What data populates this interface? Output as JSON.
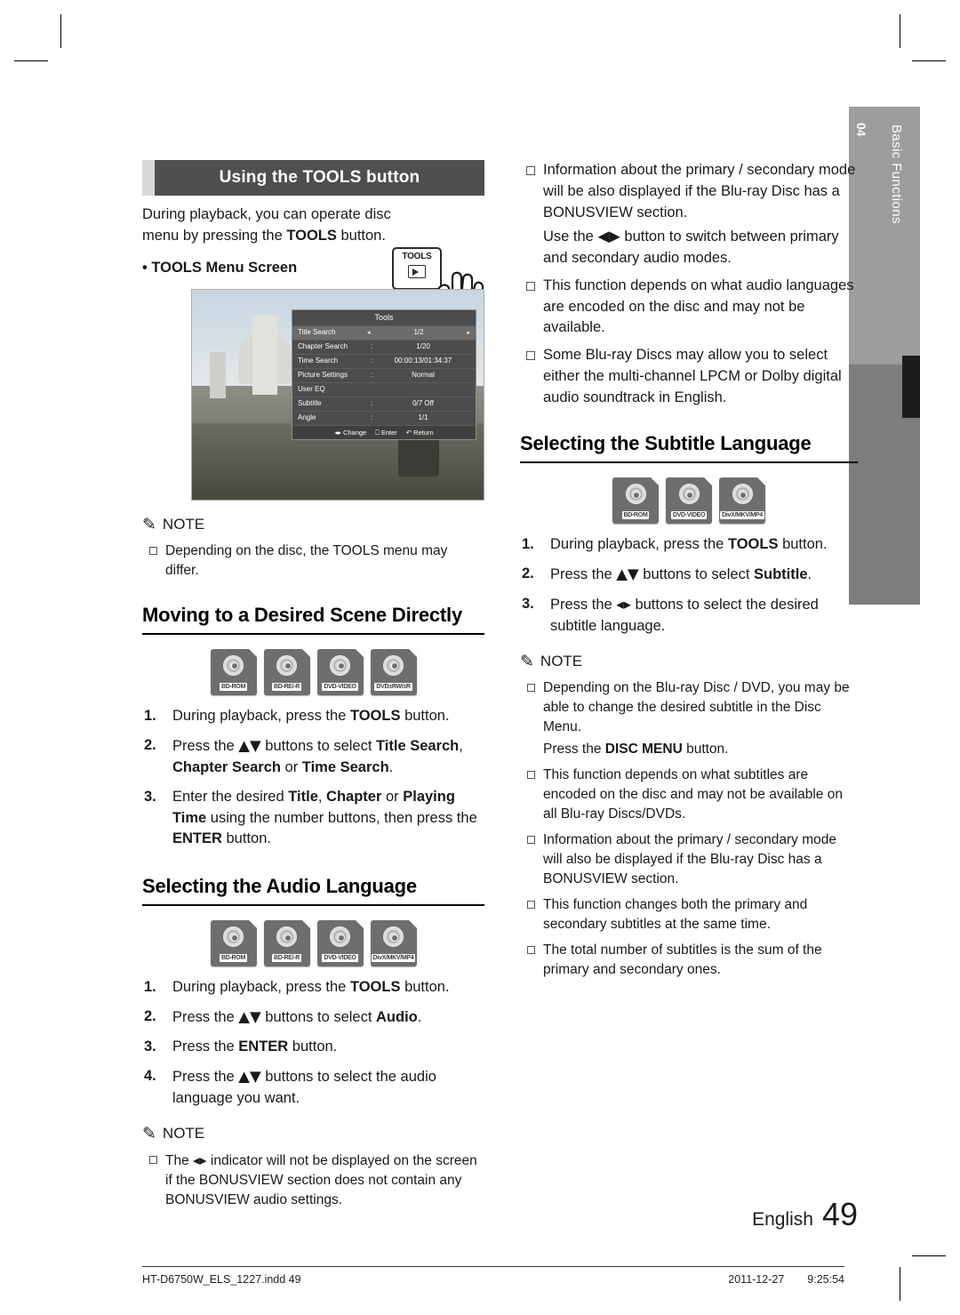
{
  "page": {
    "language_label": "English",
    "page_number": "49",
    "file_name": "HT-D6750W_ELS_1227.indd   49",
    "footer_date": "2011-12-27",
    "footer_time": "9:25:54"
  },
  "sidetab": {
    "chapter_number": "04",
    "chapter_title": "Basic Functions"
  },
  "left_column": {
    "tools_banner": "Using the TOOLS button",
    "intro_text": "During playback, you can operate disc menu by pressing the TOOLS button.",
    "intro_bold": "TOOLS",
    "tools_menu_screen_label": "• TOOLS Menu Screen",
    "tools_key_label": "TOOLS",
    "screenshot": {
      "menu_title": "Tools",
      "rows": [
        {
          "label": "Title Search",
          "value": "1/2",
          "selected": true,
          "arrows": true
        },
        {
          "label": "Chapter Search",
          "value": "1/20",
          "colon": ":",
          "selected": false
        },
        {
          "label": "Time Search",
          "value": "00:00:13/01:34:37",
          "colon": ":",
          "selected": false
        },
        {
          "label": "Picture Settings",
          "value": "Normal",
          "colon": ":",
          "selected": false
        },
        {
          "label": "User EQ",
          "value": "",
          "colon": "",
          "selected": false
        },
        {
          "label": "Subtitle",
          "value": "0/7 Off",
          "colon": ":",
          "selected": false
        },
        {
          "label": "Angle",
          "value": "1/1",
          "colon": ":",
          "selected": false
        }
      ],
      "footer": [
        "Change",
        "Enter",
        "Return"
      ]
    },
    "note1": {
      "title": "NOTE",
      "items": [
        "Depending on the disc, the TOOLS menu may differ."
      ]
    },
    "section_scene": {
      "heading": "Moving to a Desired Scene Directly",
      "discs": [
        "BD-ROM",
        "BD-RE/-R",
        "DVD-VIDEO",
        "DVD±RW/±R"
      ],
      "steps": [
        {
          "num": "1.",
          "html": "During playback, press the <b>TOOLS</b> button."
        },
        {
          "num": "2.",
          "html": "Press the ▲▼ buttons to select <b>Title Search</b>, <b>Chapter Search</b> or <b>Time Search</b>."
        },
        {
          "num": "3.",
          "html": "Enter the desired <b>Title</b>, <b>Chapter</b> or <b>Playing Time</b> using the number buttons, then press the <b>ENTER</b> button."
        }
      ]
    },
    "section_audio": {
      "heading": "Selecting the Audio Language",
      "discs": [
        "BD-ROM",
        "BD-RE/-R",
        "DVD-VIDEO",
        "DivX/MKV/MP4"
      ],
      "steps": [
        {
          "num": "1.",
          "html": "During playback, press the <b>TOOLS</b> button."
        },
        {
          "num": "2.",
          "html": "Press the ▲▼ buttons to select <b>Audio</b>."
        },
        {
          "num": "3.",
          "html": "Press the <b>ENTER</b> button."
        },
        {
          "num": "4.",
          "html": "Press the ▲▼ buttons to select the audio language you want."
        }
      ],
      "note": {
        "title": "NOTE",
        "items": [
          "The ◀▶ indicator will not be displayed on the screen if the BONUSVIEW section does not contain any BONUSVIEW audio settings."
        ]
      }
    }
  },
  "right_column": {
    "top_notes": [
      "Information about the primary / secondary mode will be also displayed if the Blu-ray Disc has a BONUSVIEW section.",
      "Use the ◀▶ button to switch between primary and secondary audio modes.",
      "This function depends on what audio languages are encoded on the disc and may not be available.",
      "Some Blu-ray Discs may allow you to select either the multi-channel LPCM or Dolby digital audio soundtrack in English."
    ],
    "top_notes_bulleted": [
      true,
      false,
      true,
      true
    ],
    "section_subtitle": {
      "heading": "Selecting the Subtitle Language",
      "discs": [
        "BD-ROM",
        "DVD-VIDEO",
        "DivX/MKV/MP4"
      ],
      "steps": [
        {
          "num": "1.",
          "html": "During playback, press the <b>TOOLS</b> button."
        },
        {
          "num": "2.",
          "html": "Press the ▲▼ buttons to select <b>Subtitle</b>."
        },
        {
          "num": "3.",
          "html": "Press the ◀▶ buttons to select the desired subtitle language."
        }
      ],
      "note": {
        "title": "NOTE",
        "items": [
          "Depending on the Blu-ray Disc / DVD, you may be able to change the desired subtitle in the Disc Menu.",
          "Press the DISC MENU button.",
          "This function depends on what subtitles are encoded on the disc and may not be available on all Blu-ray Discs/DVDs.",
          "Information about the primary / secondary mode will also be displayed if the Blu-ray Disc has a BONUSVIEW section.",
          "This function changes both the primary and secondary subtitles at the same time.",
          "The total number of subtitles is the sum of the primary and secondary ones."
        ],
        "bulleted": [
          true,
          false,
          true,
          true,
          true,
          true
        ]
      }
    }
  }
}
